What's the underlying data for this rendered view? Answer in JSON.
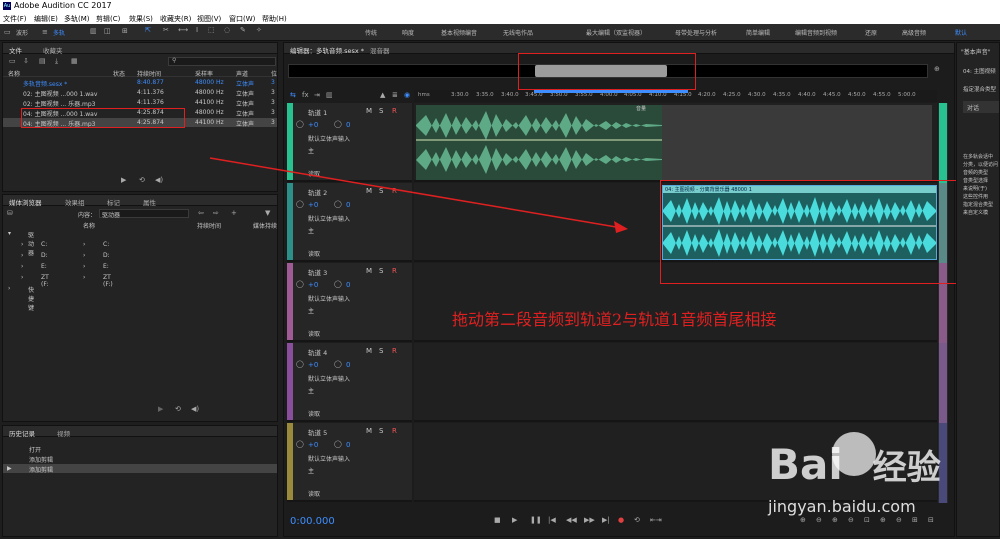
{
  "app": {
    "title": "Adobe Audition CC 2017",
    "logo": "Au"
  },
  "menu": [
    "文件(F)",
    "编辑(E)",
    "多轨(M)",
    "剪辑(C)",
    "效果(S)",
    "收藏夹(R)",
    "视图(V)",
    "窗口(W)",
    "帮助(H)"
  ],
  "toolbar": {
    "modes": [
      "波形",
      "多轨"
    ],
    "workspaces": [
      "传统",
      "响度",
      "基本视频编音",
      "无线电作品",
      "最大编辑（双监视器）",
      "母带处理与分析",
      "简单编辑",
      "编辑音频到视频",
      "还原",
      "高级音频",
      "默认"
    ]
  },
  "files_panel": {
    "tabs": [
      "文件",
      "收藏夹"
    ],
    "search_placeholder": "",
    "columns": [
      "名称",
      "状态",
      "持续时间",
      "采样率",
      "声道",
      "位"
    ],
    "rows": [
      {
        "name": "多轨音频.sesx *",
        "duration": "8:40.877",
        "rate": "48000 Hz",
        "ch": "立体声",
        "bit": "3"
      },
      {
        "name": "02: 主图视频 ...000 1.wav",
        "duration": "4:11.376",
        "rate": "48000 Hz",
        "ch": "立体声",
        "bit": "3"
      },
      {
        "name": "02: 主图视频 ... 乐器.mp3",
        "duration": "4:11.376",
        "rate": "44100 Hz",
        "ch": "立体声",
        "bit": "3"
      },
      {
        "name": "04: 主图视频 ...000 1.wav",
        "duration": "4:25.874",
        "rate": "48000 Hz",
        "ch": "立体声",
        "bit": "3"
      },
      {
        "name": "04: 主图视频 ... 乐器.mp3",
        "duration": "4:25.874",
        "rate": "44100 Hz",
        "ch": "立体声",
        "bit": "3"
      }
    ]
  },
  "media_panel": {
    "tabs": [
      "媒体浏览器",
      "效果组",
      "标记",
      "属性"
    ],
    "content_label": "内容：",
    "content_value": "驱动器",
    "col_name": "名称",
    "col_dur": "持续时间",
    "col_media": "媒体持续",
    "tree": [
      "驱动器",
      "C:",
      "D:",
      "E:",
      "ZT (F:",
      "快捷键"
    ],
    "list": [
      "C:",
      "D:",
      "E:",
      "ZT (F:)"
    ]
  },
  "history_panel": {
    "tabs": [
      "历史记录",
      "视频"
    ],
    "items": [
      "打开",
      "添加剪辑",
      "添加剪辑"
    ]
  },
  "editor": {
    "tabs": [
      "编辑器：多轨音频.sesx *",
      "混音器"
    ],
    "ruler": [
      "hms",
      "3:30.0",
      "3:35.0",
      "3:40.0",
      "3:45.0",
      "3:50.0",
      "3:55.0",
      "4:00.0",
      "4:05.0",
      "4:10.0",
      "4:15.0",
      "4:20.0",
      "4:25.0",
      "4:30.0",
      "4:35.0",
      "4:40.0",
      "4:45.0",
      "4:50.0",
      "4:55.0",
      "5:00.0",
      "5:05.0"
    ],
    "tracks": [
      {
        "name": "轨道 1",
        "vol": "+0",
        "pan": "0",
        "input": "默认立体声输入",
        "output": "主",
        "mode": "读取",
        "color": "#27c28f"
      },
      {
        "name": "轨道 2",
        "vol": "+0",
        "pan": "0",
        "input": "默认立体声输入",
        "output": "主",
        "mode": "读取",
        "color": "#2d8f8a"
      },
      {
        "name": "轨道 3",
        "vol": "+0",
        "pan": "0",
        "input": "默认立体声输入",
        "output": "主",
        "mode": "读取",
        "color": "#a05a96"
      },
      {
        "name": "轨道 4",
        "vol": "+0",
        "pan": "0",
        "input": "默认立体声输入",
        "output": "主",
        "mode": "读取",
        "color": "#8a4f9c"
      },
      {
        "name": "轨道 5",
        "vol": "+0",
        "pan": "0",
        "input": "默认立体声输入",
        "output": "主",
        "mode": "读取",
        "color": "#9c8a3c"
      }
    ],
    "clip2_label": "04: 主图视频 - 分离背景乐器 48000 1",
    "clip1_label": "音量",
    "annotation": "拖动第二段音频到轨道2与轨道1音频首尾相接",
    "time": "0:00.000",
    "msr": [
      "M",
      "S",
      "R"
    ]
  },
  "right_panel": {
    "title": "\"基本声音\"",
    "items": [
      "04: 主图视频",
      "指定混合类型",
      "对话",
      "在多轨会话中",
      "分类，以便访问",
      "音频的类型",
      "音类型选择",
      "来说明(于)",
      "这些控件用",
      "指定混合类型",
      "来自定义模"
    ]
  },
  "watermark": {
    "text": "Bai",
    "text2": "经验",
    "url": "jingyan.baidu.com"
  }
}
